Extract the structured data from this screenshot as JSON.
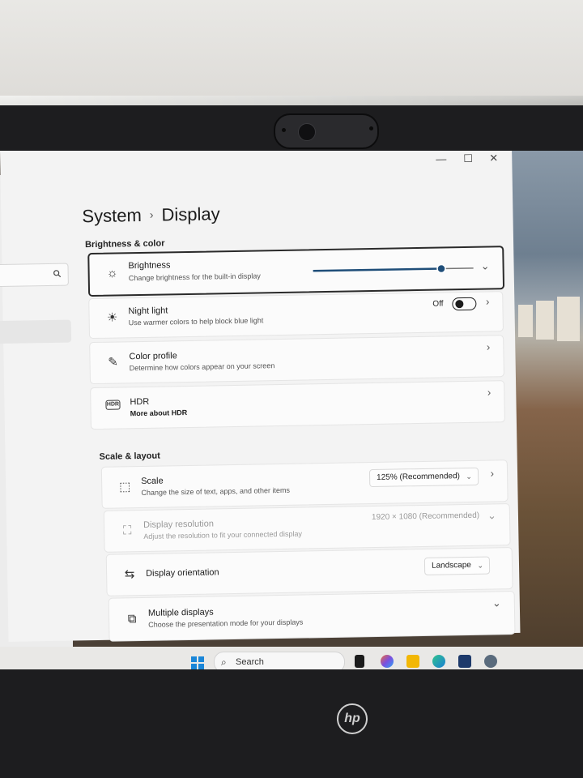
{
  "window": {
    "minimize": "—",
    "maximize": "☐",
    "close": "✕"
  },
  "breadcrumb": {
    "parent": "System",
    "separator": "›",
    "current": "Display"
  },
  "sections": {
    "brightness_color": "Brightness & color",
    "scale_layout": "Scale & layout"
  },
  "brightness": {
    "title": "Brightness",
    "subtitle": "Change brightness for the built-in display",
    "level": 0.8
  },
  "night_light": {
    "title": "Night light",
    "subtitle": "Use warmer colors to help block blue light",
    "state": "Off"
  },
  "color_profile": {
    "title": "Color profile",
    "subtitle": "Determine how colors appear on your screen"
  },
  "hdr": {
    "title": "HDR",
    "subtitle": "More about HDR",
    "icon_text": "HDR"
  },
  "scale": {
    "title": "Scale",
    "subtitle": "Change the size of text, apps, and other items",
    "value": "125% (Recommended)"
  },
  "resolution": {
    "title": "Display resolution",
    "subtitle": "Adjust the resolution to fit your connected display",
    "value": "1920 × 1080 (Recommended)"
  },
  "orientation": {
    "title": "Display orientation",
    "value": "Landscape"
  },
  "multiple": {
    "title": "Multiple displays",
    "subtitle": "Choose the presentation mode for your displays"
  },
  "taskbar": {
    "search": "Search"
  },
  "hardware": {
    "logo": "hp"
  },
  "colors": {
    "accent": "#1f4e79",
    "toggle_off": "#1b1b1b"
  }
}
